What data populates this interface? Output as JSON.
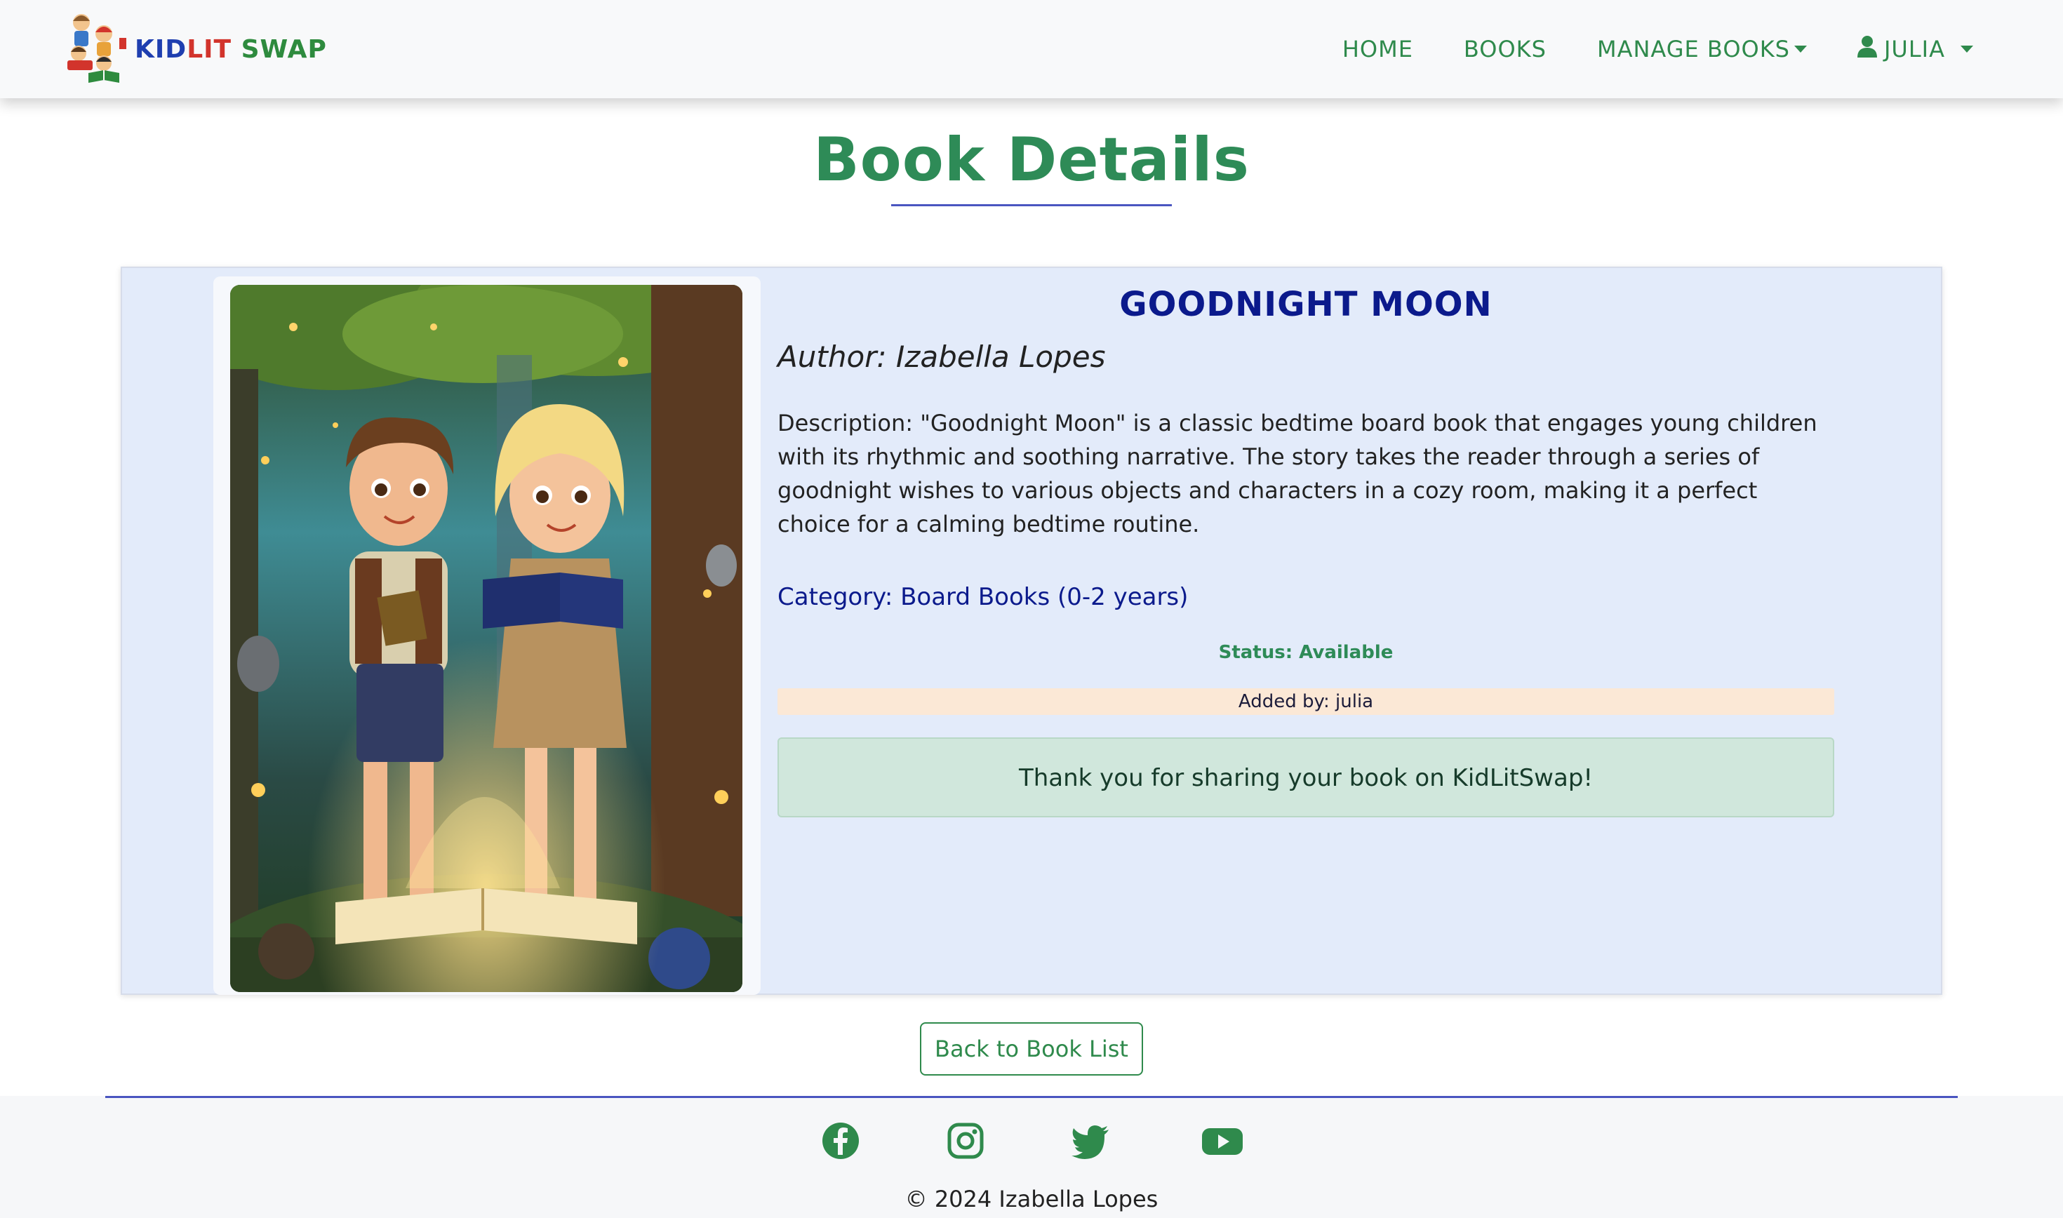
{
  "brand": {
    "kid": "KID",
    "lit": "LIT",
    "swap": "SWAP"
  },
  "nav": {
    "home": "HOME",
    "books": "BOOKS",
    "manage_books": "MANAGE BOOKS",
    "user": "JULIA"
  },
  "page": {
    "title": "Book Details"
  },
  "book": {
    "title": "GOODNIGHT MOON",
    "author": "Author: Izabella Lopes",
    "description": "Description: \"Goodnight Moon\" is a classic bedtime board book that engages young children with its rhythmic and soothing narrative. The story takes the reader through a series of goodnight wishes to various objects and characters in a cozy room, making it a perfect choice for a calming bedtime routine.",
    "category": "Category: Board Books (0-2 years)",
    "status": "Status: Available",
    "added_by": "Added by: julia",
    "thanks_message": "Thank you for sharing your book on KidLitSwap!"
  },
  "actions": {
    "back": "Back to Book List"
  },
  "footer": {
    "social": [
      "facebook-icon",
      "instagram-icon",
      "twitter-icon",
      "youtube-icon"
    ],
    "copyright": "© 2024 Izabella Lopes"
  },
  "colors": {
    "primary_green": "#2f8a4c",
    "title_navy": "#0b1a8c",
    "card_bg": "#e3ebfa",
    "accent_line": "#4a55c0"
  }
}
